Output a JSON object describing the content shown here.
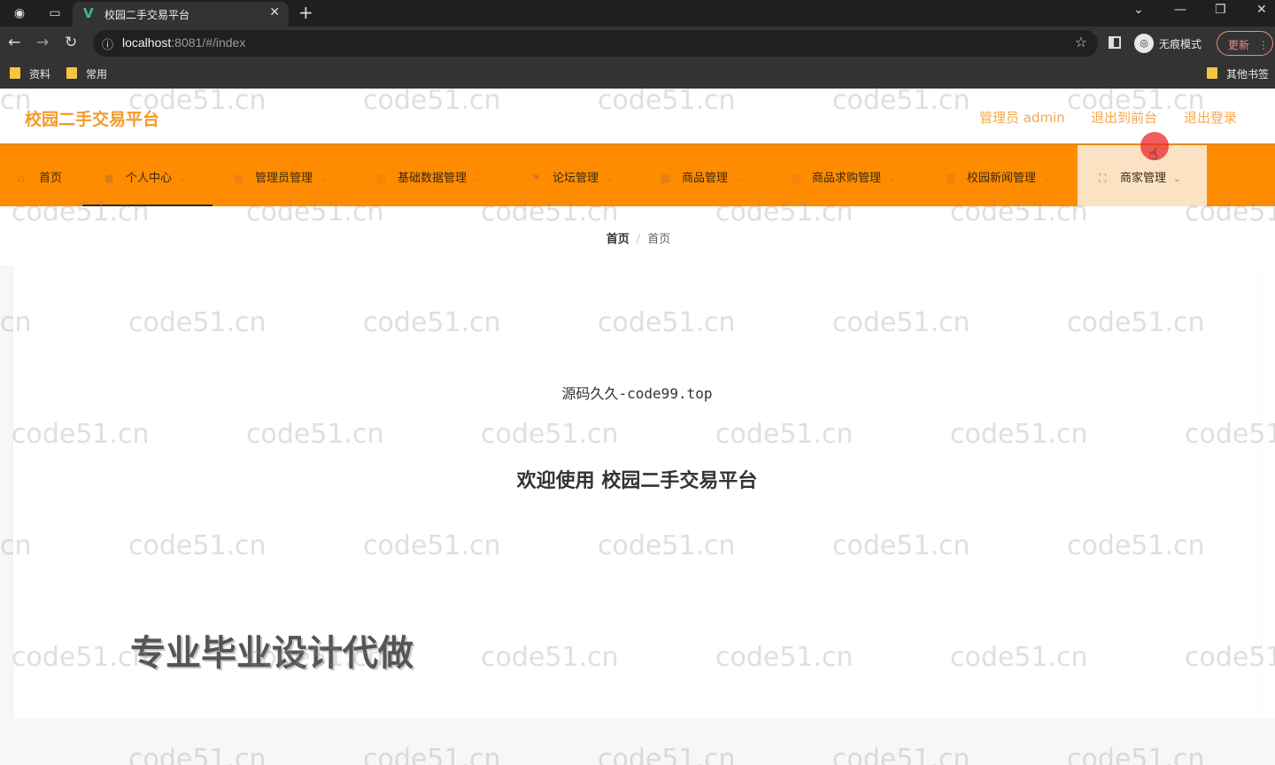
{
  "browser": {
    "tab_title": "校园二手交易平台",
    "tab_logo": "V",
    "new_tab": "+",
    "url_host": "localhost",
    "url_rest": ":8081/#/index",
    "incognito_label": "无痕模式",
    "update_label": "更新",
    "bookmarks": [
      "资料",
      "常用"
    ],
    "other_bookmarks": "其他书签"
  },
  "header": {
    "title": "校园二手交易平台",
    "admin_label": "管理员 admin",
    "back_front": "退出到前台",
    "logout": "退出登录"
  },
  "nav": [
    {
      "label": "首页",
      "icon": "home-icon"
    },
    {
      "label": "个人中心",
      "icon": "user-icon"
    },
    {
      "label": "管理员管理",
      "icon": "admin-icon"
    },
    {
      "label": "基础数据管理",
      "icon": "data-icon"
    },
    {
      "label": "论坛管理",
      "icon": "flag-icon"
    },
    {
      "label": "商品管理",
      "icon": "goods-icon"
    },
    {
      "label": "商品求购管理",
      "icon": "purchase-icon"
    },
    {
      "label": "校园新闻管理",
      "icon": "news-icon"
    },
    {
      "label": "商家管理",
      "icon": "merchant-icon"
    }
  ],
  "breadcrumb": [
    "首页",
    "首页"
  ],
  "content": {
    "promo": "源码久久-code99.top",
    "welcome": "欢迎使用 校园二手交易平台",
    "overlay_ad": "专业毕业设计代做"
  },
  "watermark": "code51.cn",
  "colors": {
    "nav_bg": "#ff8c00",
    "title": "#f39b28",
    "header_link": "#f5a84d"
  }
}
